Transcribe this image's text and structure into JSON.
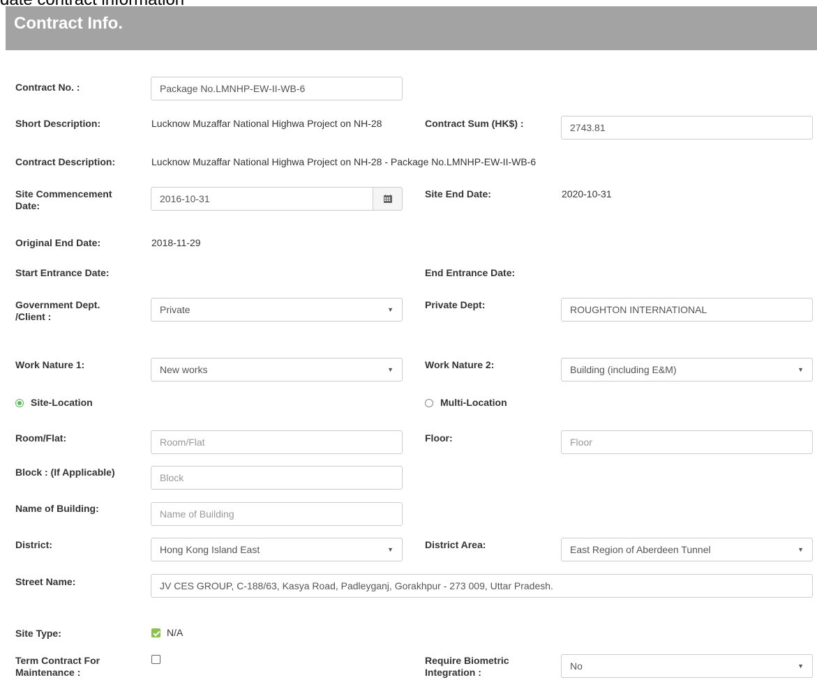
{
  "page": {
    "top_text": "date contract information",
    "section_title": "Contract Info."
  },
  "fields": {
    "contract_no": {
      "label": "Contract No. :",
      "value": "Package No.LMNHP-EW-II-WB-6"
    },
    "short_description": {
      "label": "Short Description:",
      "value": "Lucknow Muzaffar National Highwa Project on NH-28"
    },
    "contract_sum": {
      "label": "Contract Sum (HK$) :",
      "value": "2743.81"
    },
    "contract_description": {
      "label": "Contract Description:",
      "value": "Lucknow Muzaffar National Highwa Project on NH-28 - Package No.LMNHP-EW-II-WB-6"
    },
    "site_commencement": {
      "label_line1": "Site Commencement",
      "label_line2": "Date:",
      "value": "2016-10-31"
    },
    "site_end": {
      "label": "Site End Date:",
      "value": "2020-10-31"
    },
    "original_end": {
      "label": "Original End Date:",
      "value": "2018-11-29"
    },
    "start_entrance": {
      "label": "Start Entrance Date:"
    },
    "end_entrance": {
      "label": "End Entrance Date:"
    },
    "government_dept": {
      "label_line1": "Government Dept.",
      "label_line2": "/Client :",
      "value": "Private"
    },
    "private_dept": {
      "label": "Private Dept:",
      "value": "ROUGHTON INTERNATIONAL"
    },
    "work_nature_1": {
      "label": "Work Nature 1:",
      "value": "New works"
    },
    "work_nature_2": {
      "label": "Work Nature 2:",
      "value": "Building (including E&M)"
    },
    "location_mode": {
      "site_label": "Site-Location",
      "multi_label": "Multi-Location",
      "selected": "Site-Location"
    },
    "room_flat": {
      "label": "Room/Flat:",
      "placeholder": "Room/Flat"
    },
    "floor": {
      "label": "Floor:",
      "placeholder": "Floor"
    },
    "block": {
      "label": "Block : (If Applicable)",
      "placeholder": "Block"
    },
    "building_name": {
      "label": "Name of Building:",
      "placeholder": "Name of Building"
    },
    "district": {
      "label": "District:",
      "value": "Hong Kong Island East"
    },
    "district_area": {
      "label": "District Area:",
      "value": "East Region of Aberdeen Tunnel"
    },
    "street_name": {
      "label": "Street Name:",
      "value": "JV CES GROUP, C-188/63, Kasya Road, Padleyganj, Gorakhpur - 273 009, Uttar Pradesh."
    },
    "site_type": {
      "label": "Site Type:",
      "option": "N/A",
      "checked": true
    },
    "term_contract": {
      "label_line1": "Term Contract For",
      "label_line2": "Maintenance :",
      "checked": false
    },
    "biometric": {
      "label_line1": "Require Biometric",
      "label_line2": "Integration :",
      "value": "No"
    }
  },
  "colors": {
    "header_bg": "#a3a3a3",
    "accent_green": "#8bc34a"
  }
}
